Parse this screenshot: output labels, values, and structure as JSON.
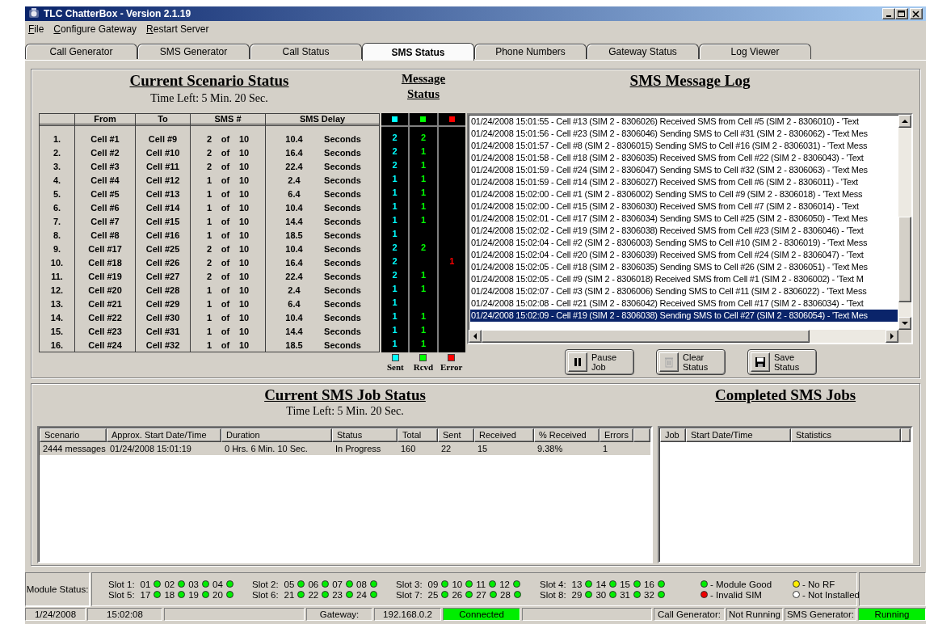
{
  "window": {
    "title": "TLC ChatterBox - Version 2.1.19"
  },
  "menu": [
    "File",
    "Configure Gateway",
    "Restart Server"
  ],
  "tabs": [
    {
      "label": "Call Generator",
      "selected": false
    },
    {
      "label": "SMS Generator",
      "selected": false
    },
    {
      "label": "Call Status",
      "selected": false
    },
    {
      "label": "SMS Status",
      "selected": true
    },
    {
      "label": "Phone Numbers",
      "selected": false
    },
    {
      "label": "Gateway Status",
      "selected": false
    },
    {
      "label": "Log Viewer",
      "selected": false
    }
  ],
  "scenario": {
    "title": "Current Scenario Status",
    "time_left": "Time Left:  5 Min.  20 Sec.",
    "columns": [
      "From",
      "To",
      "SMS #",
      "SMS Delay"
    ],
    "rows": [
      {
        "index": "1.",
        "from": "Cell #1",
        "to": "Cell #9",
        "sms": [
          "2",
          "of",
          "10"
        ],
        "delay": [
          "10.4",
          "Seconds"
        ],
        "sent": "2",
        "rcvd": "2"
      },
      {
        "index": "2.",
        "from": "Cell #2",
        "to": "Cell #10",
        "sms": [
          "2",
          "of",
          "10"
        ],
        "delay": [
          "16.4",
          "Seconds"
        ],
        "sent": "2",
        "rcvd": "1"
      },
      {
        "index": "3.",
        "from": "Cell #3",
        "to": "Cell #11",
        "sms": [
          "2",
          "of",
          "10"
        ],
        "delay": [
          "22.4",
          "Seconds"
        ],
        "sent": "2",
        "rcvd": "1"
      },
      {
        "index": "4.",
        "from": "Cell #4",
        "to": "Cell #12",
        "sms": [
          "1",
          "of",
          "10"
        ],
        "delay": [
          "2.4",
          "Seconds"
        ],
        "sent": "1",
        "rcvd": "1"
      },
      {
        "index": "5.",
        "from": "Cell #5",
        "to": "Cell #13",
        "sms": [
          "1",
          "of",
          "10"
        ],
        "delay": [
          "6.4",
          "Seconds"
        ],
        "sent": "1",
        "rcvd": "1"
      },
      {
        "index": "6.",
        "from": "Cell #6",
        "to": "Cell #14",
        "sms": [
          "1",
          "of",
          "10"
        ],
        "delay": [
          "10.4",
          "Seconds"
        ],
        "sent": "1",
        "rcvd": "1"
      },
      {
        "index": "7.",
        "from": "Cell #7",
        "to": "Cell #15",
        "sms": [
          "1",
          "of",
          "10"
        ],
        "delay": [
          "14.4",
          "Seconds"
        ],
        "sent": "1",
        "rcvd": "1"
      },
      {
        "index": "8.",
        "from": "Cell #8",
        "to": "Cell #16",
        "sms": [
          "1",
          "of",
          "10"
        ],
        "delay": [
          "18.5",
          "Seconds"
        ],
        "sent": "1"
      },
      {
        "index": "9.",
        "from": "Cell #17",
        "to": "Cell #25",
        "sms": [
          "2",
          "of",
          "10"
        ],
        "delay": [
          "10.4",
          "Seconds"
        ],
        "sent": "2",
        "rcvd": "2"
      },
      {
        "index": "10.",
        "from": "Cell #18",
        "to": "Cell #26",
        "sms": [
          "2",
          "of",
          "10"
        ],
        "delay": [
          "16.4",
          "Seconds"
        ],
        "sent": "2",
        "error": "1"
      },
      {
        "index": "11.",
        "from": "Cell #19",
        "to": "Cell #27",
        "sms": [
          "2",
          "of",
          "10"
        ],
        "delay": [
          "22.4",
          "Seconds"
        ],
        "sent": "2",
        "rcvd": "1"
      },
      {
        "index": "12.",
        "from": "Cell #20",
        "to": "Cell #28",
        "sms": [
          "1",
          "of",
          "10"
        ],
        "delay": [
          "2.4",
          "Seconds"
        ],
        "sent": "1",
        "rcvd": "1"
      },
      {
        "index": "13.",
        "from": "Cell #21",
        "to": "Cell #29",
        "sms": [
          "1",
          "of",
          "10"
        ],
        "delay": [
          "6.4",
          "Seconds"
        ],
        "sent": "1"
      },
      {
        "index": "14.",
        "from": "Cell #22",
        "to": "Cell #30",
        "sms": [
          "1",
          "of",
          "10"
        ],
        "delay": [
          "10.4",
          "Seconds"
        ],
        "sent": "1",
        "rcvd": "1"
      },
      {
        "index": "15.",
        "from": "Cell #23",
        "to": "Cell #31",
        "sms": [
          "1",
          "of",
          "10"
        ],
        "delay": [
          "14.4",
          "Seconds"
        ],
        "sent": "1",
        "rcvd": "1"
      },
      {
        "index": "16.",
        "from": "Cell #24",
        "to": "Cell #32",
        "sms": [
          "1",
          "of",
          "10"
        ],
        "delay": [
          "18.5",
          "Seconds"
        ],
        "sent": "1",
        "rcvd": "1"
      }
    ]
  },
  "message_status": {
    "title": "Message Status",
    "columns": [
      {
        "label": "Sent",
        "color": "#00ffff"
      },
      {
        "label": "Rcvd",
        "color": "#00ff00"
      },
      {
        "label": "Error",
        "color": "#ff0000"
      }
    ]
  },
  "log": {
    "title": "SMS Message Log",
    "entries": [
      {
        "text": "01/24/2008 15:01:55 - Cell #13 (SIM 2 - 8306026) Received SMS from Cell #5  (SIM 2 - 8306010) - 'Text",
        "selected": false
      },
      {
        "text": "01/24/2008 15:01:56 - Cell #23 (SIM 2 - 8306046) Sending SMS to Cell #31 (SIM 2 - 8306062) - 'Text Mes",
        "selected": false
      },
      {
        "text": "01/24/2008 15:01:57 - Cell #8 (SIM 2 - 8306015) Sending SMS to Cell #16 (SIM 2 - 8306031) - 'Text Mess",
        "selected": false
      },
      {
        "text": "01/24/2008 15:01:58 - Cell #18 (SIM 2 - 8306035) Received SMS from Cell #22 (SIM 2 - 8306043) - 'Text",
        "selected": false
      },
      {
        "text": "01/24/2008 15:01:59 - Cell #24 (SIM 2 - 8306047) Sending SMS to Cell #32 (SIM 2 - 8306063) - 'Text Mes",
        "selected": false
      },
      {
        "text": "01/24/2008 15:01:59 - Cell #14 (SIM 2 - 8306027) Received SMS from Cell #6  (SIM 2 - 8306011) - 'Text",
        "selected": false
      },
      {
        "text": "01/24/2008 15:02:00 - Cell #1 (SIM 2 - 8306002) Sending SMS to Cell #9 (SIM 2 - 8306018) - 'Text Mess",
        "selected": false
      },
      {
        "text": "01/24/2008 15:02:00 - Cell #15 (SIM 2 - 8306030) Received SMS from Cell #7  (SIM 2 - 8306014) - 'Text",
        "selected": false
      },
      {
        "text": "01/24/2008 15:02:01 - Cell #17 (SIM 2 - 8306034) Sending SMS to Cell #25 (SIM 2 - 8306050) - 'Text Mes",
        "selected": false
      },
      {
        "text": "01/24/2008 15:02:02 - Cell #19 (SIM 2 - 8306038) Received SMS from Cell #23 (SIM 2 - 8306046) - 'Text",
        "selected": false
      },
      {
        "text": "01/24/2008 15:02:04 - Cell #2 (SIM 2 - 8306003) Sending SMS to Cell #10 (SIM 2 - 8306019) - 'Text Mess",
        "selected": false
      },
      {
        "text": "01/24/2008 15:02:04 - Cell #20 (SIM 2 - 8306039) Received SMS from Cell #24 (SIM 2 - 8306047) - 'Text",
        "selected": false
      },
      {
        "text": "01/24/2008 15:02:05 - Cell #18 (SIM 2 - 8306035) Sending SMS to Cell #26 (SIM 2 - 8306051) - 'Text Mes",
        "selected": false
      },
      {
        "text": "01/24/2008 15:02:05 - Cell #9 (SIM 2 - 8306018) Received SMS from Cell #1  (SIM 2 - 8306002) - 'Text M",
        "selected": false
      },
      {
        "text": "01/24/2008 15:02:07 - Cell #3 (SIM 2 - 8306006) Sending SMS to Cell #11 (SIM 2 - 8306022) - 'Text Mess",
        "selected": false
      },
      {
        "text": "01/24/2008 15:02:08 - Cell #21 (SIM 2 - 8306042) Received SMS from Cell #17 (SIM 2 - 8306034) - 'Text",
        "selected": false
      },
      {
        "text": "01/24/2008 15:02:09 - Cell #19 (SIM 2 - 8306038) Sending SMS to Cell #27 (SIM 2 - 8306054) - 'Text Mes",
        "selected": true
      }
    ]
  },
  "buttons": [
    {
      "label": "Pause Job",
      "kind": "pause",
      "disabled": false
    },
    {
      "label": "Clear Status",
      "kind": "clear",
      "disabled": true
    },
    {
      "label": "Save Status",
      "kind": "save",
      "disabled": false
    }
  ],
  "job_status": {
    "title": "Current SMS Job Status",
    "time_left": "Time Left:  5 Min.  20 Sec.",
    "columns": [
      "Scenario",
      "Approx. Start Date/Time",
      "Duration",
      "Status",
      "Total",
      "Sent",
      "Received",
      "% Received",
      "Errors"
    ],
    "rows": [
      {
        "cells": [
          "2444 messages",
          "01/24/2008 15:01:19",
          "0 Hrs. 6 Min. 10 Sec.",
          "In Progress",
          "160",
          "22",
          "15",
          "9.38%",
          "1"
        ],
        "selected": true
      }
    ]
  },
  "completed_jobs": {
    "title": "Completed SMS Jobs",
    "columns": [
      "Job",
      "Start Date/Time",
      "Statistics"
    ]
  },
  "module_status": {
    "label": "Module Status:",
    "slots": [
      {
        "label": "Slot 1:",
        "modules": [
          {
            "number": "01",
            "color": "#00ee00"
          },
          {
            "number": "02",
            "color": "#00ee00"
          },
          {
            "number": "03",
            "color": "#00ee00"
          },
          {
            "number": "04",
            "color": "#00ee00"
          }
        ]
      },
      {
        "label": "Slot 2:",
        "modules": [
          {
            "number": "05",
            "color": "#00ee00"
          },
          {
            "number": "06",
            "color": "#00ee00"
          },
          {
            "number": "07",
            "color": "#00ee00"
          },
          {
            "number": "08",
            "color": "#00ee00"
          }
        ]
      },
      {
        "label": "Slot 3:",
        "modules": [
          {
            "number": "09",
            "color": "#00ee00"
          },
          {
            "number": "10",
            "color": "#00ee00"
          },
          {
            "number": "11",
            "color": "#00ee00"
          },
          {
            "number": "12",
            "color": "#00ee00"
          }
        ]
      },
      {
        "label": "Slot 4:",
        "modules": [
          {
            "number": "13",
            "color": "#00ee00"
          },
          {
            "number": "14",
            "color": "#00ee00"
          },
          {
            "number": "15",
            "color": "#00ee00"
          },
          {
            "number": "16",
            "color": "#00ee00"
          }
        ]
      },
      {
        "label": "Slot 5:",
        "modules": [
          {
            "number": "17",
            "color": "#00ee00"
          },
          {
            "number": "18",
            "color": "#00ee00"
          },
          {
            "number": "19",
            "color": "#00ee00"
          },
          {
            "number": "20",
            "color": "#00ee00"
          }
        ]
      },
      {
        "label": "Slot 6:",
        "modules": [
          {
            "number": "21",
            "color": "#00ee00"
          },
          {
            "number": "22",
            "color": "#00ee00"
          },
          {
            "number": "23",
            "color": "#00ee00"
          },
          {
            "number": "24",
            "color": "#00ee00"
          }
        ]
      },
      {
        "label": "Slot 7:",
        "modules": [
          {
            "number": "25",
            "color": "#00ee00"
          },
          {
            "number": "26",
            "color": "#00ee00"
          },
          {
            "number": "27",
            "color": "#00ee00"
          },
          {
            "number": "28",
            "color": "#00ee00"
          }
        ]
      },
      {
        "label": "Slot 8:",
        "modules": [
          {
            "number": "29",
            "color": "#00ee00"
          },
          {
            "number": "30",
            "color": "#00ee00"
          },
          {
            "number": "31",
            "color": "#00ee00"
          },
          {
            "number": "32",
            "color": "#00ee00"
          }
        ]
      }
    ],
    "legend": [
      {
        "color": "#00ee00",
        "label": "- Module Good"
      },
      {
        "color": "#ffee00",
        "label": "- No RF"
      },
      {
        "color": "#ee0000",
        "label": "- Invalid SIM"
      },
      {
        "color": "#ffffff",
        "label": "- Not Installed"
      }
    ]
  },
  "status_bar": [
    {
      "kind": "text",
      "text": "1/24/2008",
      "highlight": false
    },
    {
      "kind": "text",
      "text": "15:02:08",
      "highlight": false
    },
    {
      "kind": "blank"
    },
    {
      "kind": "text",
      "text": "Gateway:",
      "highlight": false
    },
    {
      "kind": "text",
      "text": "192.168.0.2",
      "highlight": false
    },
    {
      "kind": "text",
      "text": "Connected",
      "highlight": true
    },
    {
      "kind": "blank"
    },
    {
      "kind": "text",
      "text": "Call Generator:",
      "highlight": false
    },
    {
      "kind": "text",
      "text": "Not Running",
      "highlight": false
    },
    {
      "kind": "text",
      "text": "SMS Generator:",
      "highlight": false
    },
    {
      "kind": "text",
      "text": "Running",
      "highlight": true
    }
  ]
}
